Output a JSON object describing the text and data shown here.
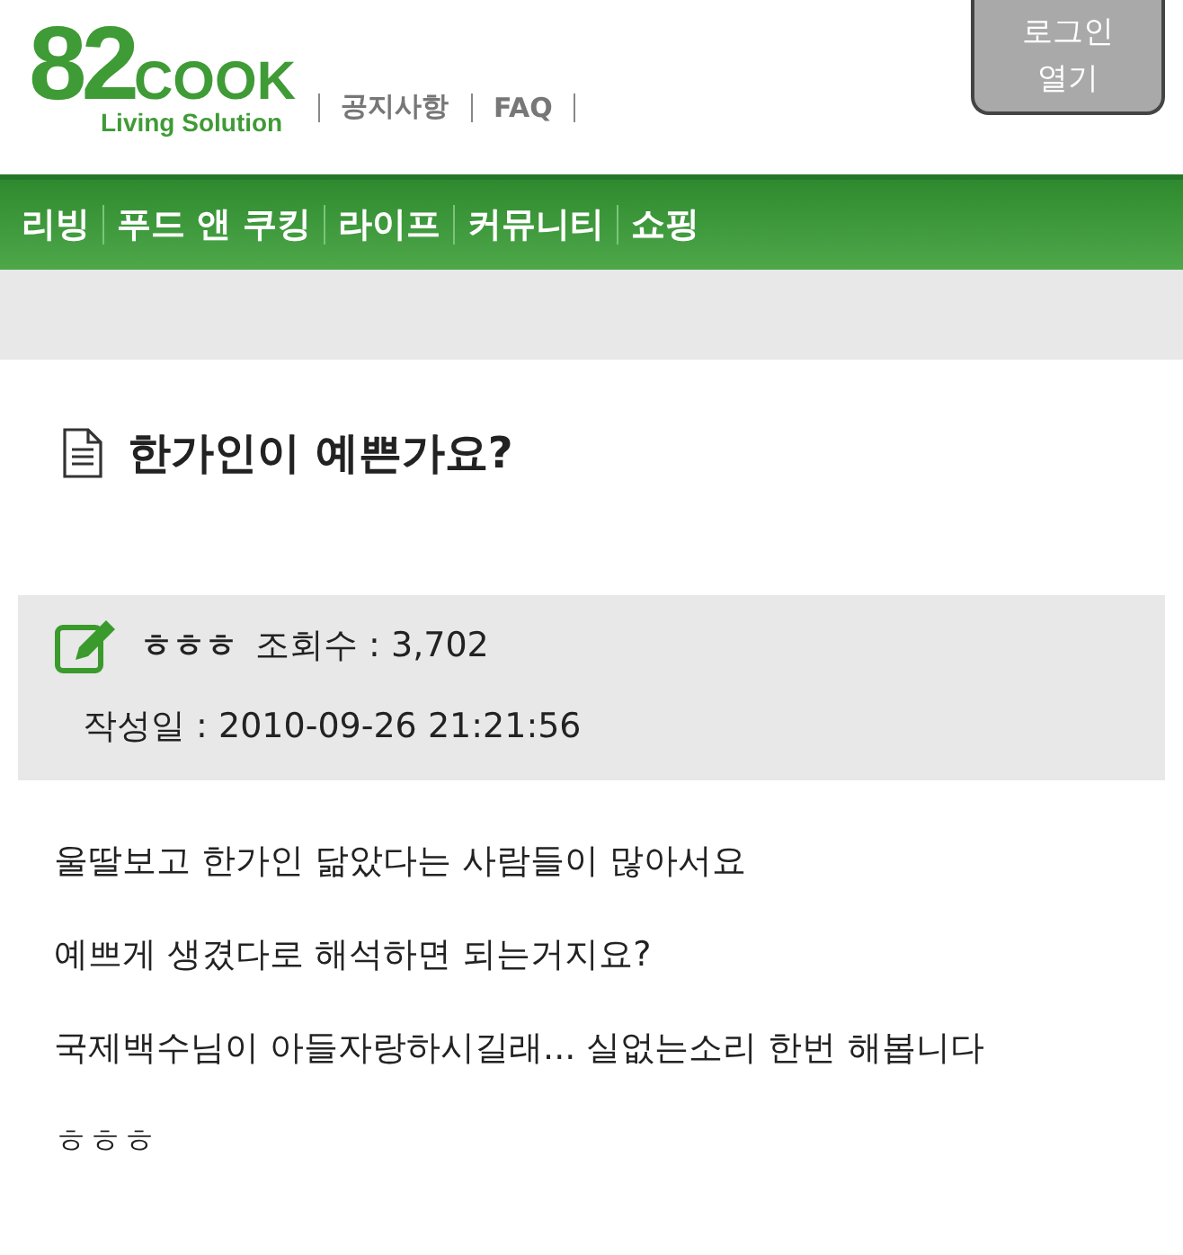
{
  "logo": {
    "number": "82",
    "word": "COOK",
    "tagline": "Living Solution"
  },
  "header_links": [
    "공지사항",
    "FAQ"
  ],
  "login_button": {
    "line_1": "로그인",
    "line_2": "열기"
  },
  "nav": [
    "리빙",
    "푸드 앤 쿠킹",
    "라이프",
    "커뮤니티",
    "쇼핑"
  ],
  "post": {
    "title": "한가인이 예쁜가요?",
    "author": "ㅎㅎㅎ",
    "views_label": "조회수 : 3,702",
    "date_label": "작성일 : 2010-09-26 21:21:56",
    "body": [
      "울딸보고 한가인 닮았다는 사람들이 많아서요",
      "예쁘게 생겼다로 해석하면 되는거지요?",
      "국제백수님이 아들자랑하시길래... 실없는소리 한번 해봅니다",
      "ㅎㅎㅎ"
    ]
  }
}
